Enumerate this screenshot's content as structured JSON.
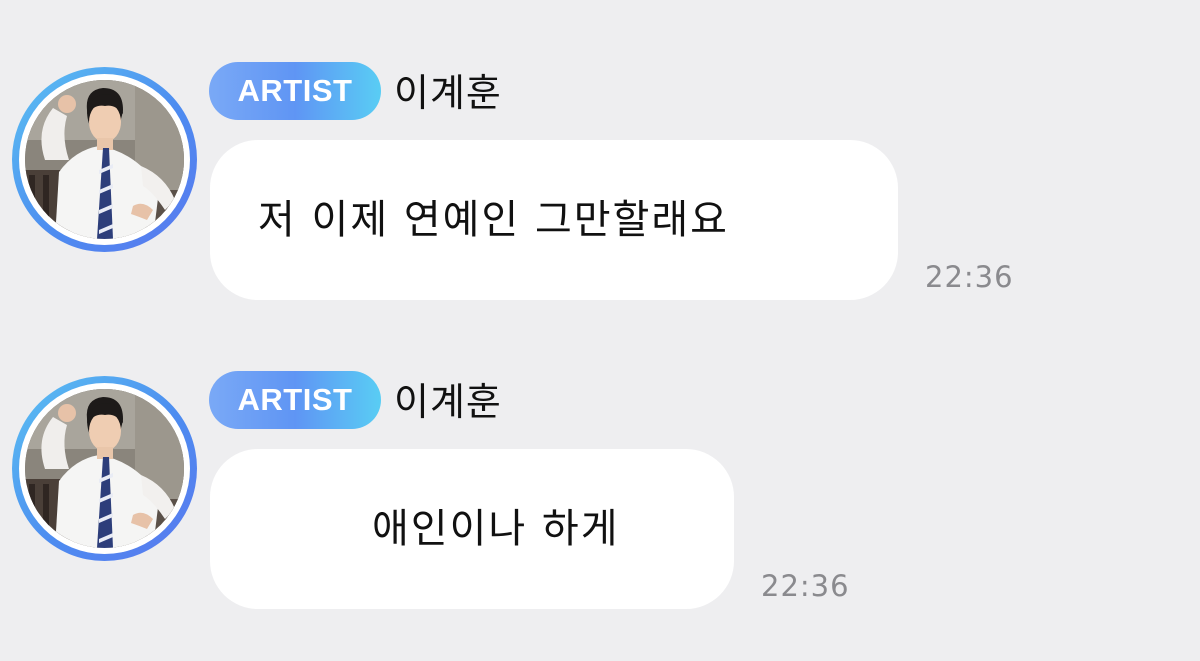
{
  "messages": [
    {
      "badge": "ARTIST",
      "sender": "이계훈",
      "text": "저 이제 연예인 그만할래요",
      "time": "22:36"
    },
    {
      "badge": "ARTIST",
      "sender": "이계훈",
      "text": "애인이나 하게",
      "time": "22:36"
    }
  ],
  "colors": {
    "background": "#eeeef0",
    "bubble": "#ffffff",
    "badge_gradient_start": "#7aa9f6",
    "badge_gradient_end": "#59cdf4",
    "avatar_ring": "#4d8cf0",
    "timestamp": "#8a8a8e"
  }
}
